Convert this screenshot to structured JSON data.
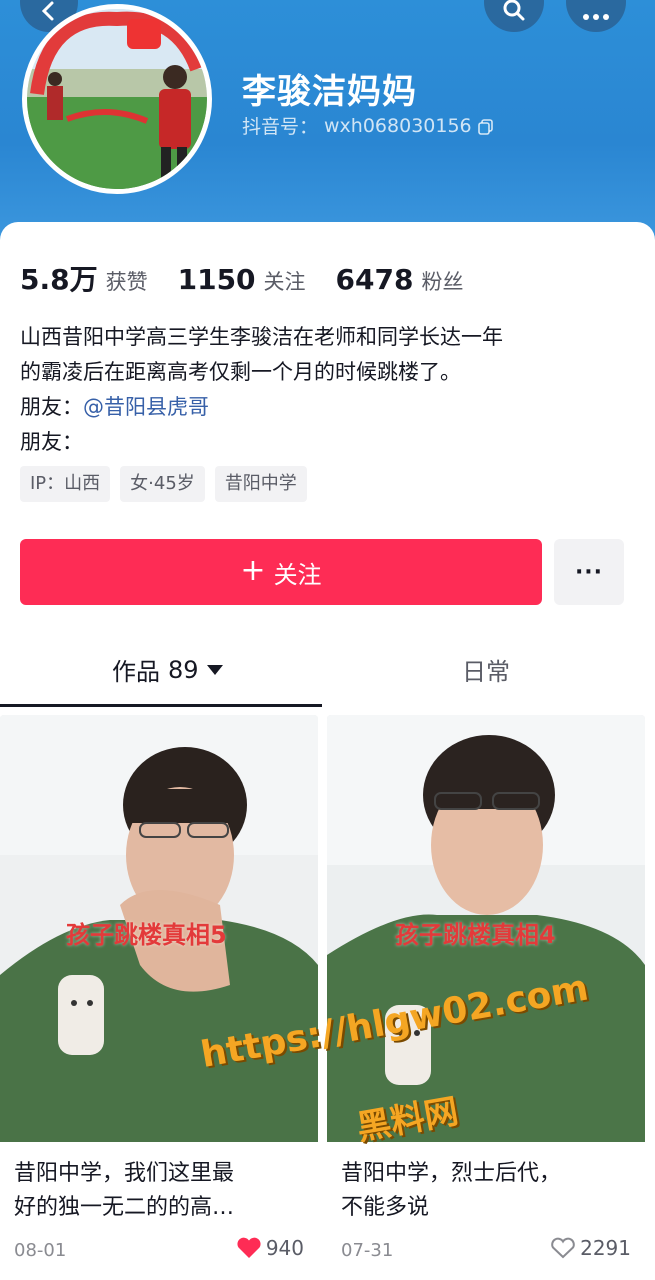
{
  "header": {
    "name": "李骏洁妈妈",
    "douyin_id_label": "抖音号：",
    "douyin_id": "wxh068030156"
  },
  "stats": [
    {
      "value": "5.8万",
      "label": "获赞"
    },
    {
      "value": "1150",
      "label": "关注"
    },
    {
      "value": "6478",
      "label": "粉丝"
    }
  ],
  "bio": {
    "line1": "山西昔阳中学高三学生李骏洁在老师和同学长达一年",
    "line2": "的霸凌后在距离高考仅剩一个月的时候跳楼了。",
    "friend_label_1": "朋友：",
    "friend_mention": "@昔阳县虎哥",
    "friend_label_2": "朋友："
  },
  "tags": [
    "IP：山西",
    "女·45岁",
    "昔阳中学"
  ],
  "actions": {
    "follow_label": "关注",
    "more_label": "···"
  },
  "tabs": {
    "works_label": "作品",
    "works_count": "89",
    "daily_label": "日常"
  },
  "videos": [
    {
      "overlay": "孩子跳楼真相5",
      "title_line1": "昔阳中学，我们这里最",
      "title_line2": "好的独一无二的的高…",
      "date": "08-01",
      "likes": "940",
      "liked": true
    },
    {
      "overlay": "孩子跳楼真相4",
      "title_line1": "昔阳中学，烈士后代，",
      "title_line2": "不能多说",
      "date": "07-31",
      "likes": "2291",
      "liked": false
    }
  ],
  "watermark": {
    "url": "https://hlgw02.com",
    "text": "黑料网"
  },
  "colors": {
    "header_blue": "#2d8fd8",
    "follow_red": "#fe2c55",
    "mention_blue": "#3760a8",
    "watermark_orange": "#f5a623"
  },
  "icons": [
    "back-icon",
    "search-icon",
    "more-icon",
    "copy-icon",
    "plus-icon",
    "caret-down-icon",
    "heart-filled-icon",
    "heart-outline-icon"
  ]
}
